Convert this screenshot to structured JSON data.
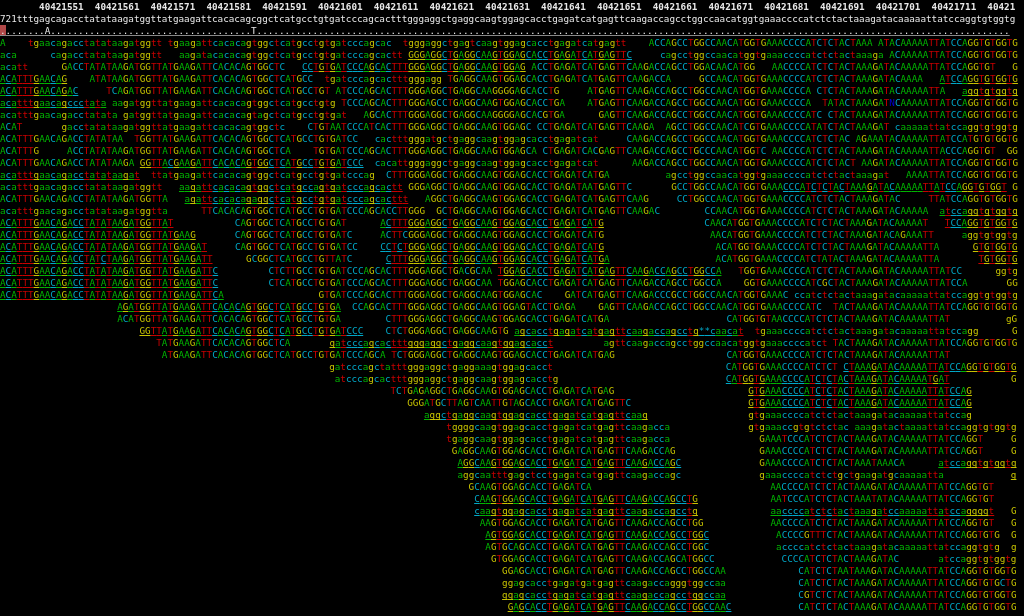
{
  "ruler": "       40421551  40421561  40421571  40421581  40421591  40421601  40421611  40421621  40421631  40421641  40421651  40421661  40421671  40421681  40421691  40421701  40421711  40421",
  "reference": "721tttgagcagacctatataagatggttatgaagattcacacagcggctcatgcctgtgatcccagcactttgggaggctgaggcaagtggagcacctgagatcatgagttcaagaccagcctggccaacatggtgaaaccccatctctactaaagatacaaaaattatccaggtgtggtg",
  "consensus": [
    {
      "text": ".",
      "highlighted": true
    },
    {
      "text": ".......A....................................T.......................................................................................................................................",
      "highlighted": false
    }
  ],
  "rows": [
    {
      "reads": [
        {
          "text": "A",
          "underlined": false
        },
        {
          "text": "    tgaacagacctatataagatggtt",
          "underlined": false
        },
        {
          "text": " tgaagattcacacagtggctcatgcctgtgatcccagcac",
          "underlined": false
        },
        {
          "text": "  tgggaggctgagtcaagtggagcacctgagatcatgagtt",
          "underlined": false
        },
        {
          "text": "    ACCAGCCTGGCCAACATGGTGAAACCCCATCTCTACTAAA",
          "underlined": false
        },
        {
          "text": " ATACAAAAATTATCCAGGTGTGGTG",
          "underlined": false
        }
      ]
    },
    {
      "reads": [
        {
          "text": "aca",
          "underlined": false
        },
        {
          "text": "      cagacctatataagatggtt",
          "underlined": false
        },
        {
          "text": "   aagatacacacagtggctcatgcctgtgatcccagcactt",
          "underlined": false
        },
        {
          "text": " GGGAGGCTGAGGCAAGTGGAGCACCTGAGATCATGAGTTC",
          "underlined": true
        },
        {
          "text": "     cagcctggccaacatggtgaaaccccatctctactaaaga",
          "underlined": false
        },
        {
          "text": " ACAAAAATTATCCAGGTGTGGTG",
          "underlined": false
        }
      ]
    },
    {
      "reads": [
        {
          "text": "acatt",
          "underlined": false
        },
        {
          "text": "      GACCTATATAAGATGGTTATGAAGATTCACACAGTGGCTC",
          "underlined": false
        },
        {
          "text": "   CCTGTGATCCCAGCACTTTGGGAGGCTGAGGCAAGTGGAG",
          "underlined": true
        },
        {
          "text": " ACCTGAGATCATGAGTTCAAGACCAGCCTGGACAACATGG",
          "underlined": false
        },
        {
          "text": "   AACCCCATCTCTACTAAAGATACAAAAATTATCCAGGTGT",
          "underlined": false
        },
        {
          "text": "   G",
          "underlined": false
        }
      ]
    },
    {
      "reads": [
        {
          "text": "ACATTTGAACAG",
          "underlined": true
        },
        {
          "text": "    ATATAAGATGGTTATGAAGATTCACACAGTGGCTCATGCC",
          "underlined": false
        },
        {
          "text": "  tgatcccagcactttgggagg",
          "underlined": false
        },
        {
          "text": " TGAGGCAAGTGGAGCACCTGAGATCATGAGTTCAAGACCA",
          "underlined": false
        },
        {
          "text": "     GCCAACATGGTGAAACCCCATCTCTACTAAAGATACAAAA",
          "underlined": false
        },
        {
          "text": "   ATCCAGGTGTGGTG",
          "underlined": true
        }
      ]
    },
    {
      "reads": [
        {
          "text": "ACATTTGAACAGAC",
          "underlined": true
        },
        {
          "text": "     TCAGATGGTTATGAAGATTCACACAGTGGCTCATGCCTGT",
          "underlined": false
        },
        {
          "text": " ATCCCAGCACTTTGGGAGGCTGAGGCAAGGGGAGCACCTG",
          "underlined": false
        },
        {
          "text": "     ATGAGTTCAAGACCAGCCTGGCCAACATGGTGAAACCCCA",
          "underlined": false
        },
        {
          "text": " CTCTACTAAAGATACAAAAATTA",
          "underlined": false
        },
        {
          "text": "   aggtgtggtg",
          "underlined": true
        }
      ]
    },
    {
      "reads": [
        {
          "text": "acatttgaacagccctata",
          "underlined": true
        },
        {
          "text": " aagatggttatgaagattcacacagtggctcatgcctgtg",
          "underlined": false
        },
        {
          "text": " TCCCAGCACTTTGGGAGCCTGAGGCAAGTGGAGCACCTGA",
          "underlined": false
        },
        {
          "text": "    ATGAGTTCAAGACCAGCCTGGCCAACATGGTGAAACCCCA",
          "underlined": false
        },
        {
          "text": "  TATACTAAAGATNCAAAAATTATCCAGGTGTGGTG",
          "underlined": false
        }
      ]
    },
    {
      "reads": [
        {
          "text": "acatttgaacagacctatata",
          "underlined": false
        },
        {
          "text": " gatggttatgaagattcacacagtagctcatgcctgtgat",
          "underlined": false
        },
        {
          "text": "   AGCACTTTGGGAGGCTGAGGCAAGGGGAGCACGTGA",
          "underlined": false
        },
        {
          "text": "      GAGTTCAAGACCAGCCTGGCCAACATGGTGAAACCCCATC",
          "underlined": false
        },
        {
          "text": " CTACTAAAGATACAAAAATTATCCAGGTGTGGTG",
          "underlined": false
        }
      ]
    },
    {
      "reads": [
        {
          "text": "ACAT",
          "underlined": false
        },
        {
          "text": "       gacctatataagatggttatgaagattcacacagtggctc",
          "underlined": false
        },
        {
          "text": "    CTGTAATCCCATCACTTTGGGAGGCTGAGGCAAGTGGAGC",
          "underlined": false
        },
        {
          "text": " CCTGAGATCATGAGTTCAAGA",
          "underlined": false
        },
        {
          "text": "  AGCCTGGCCAACATCGTGAAACCCCATATCTACTAAAGAT",
          "underlined": false
        },
        {
          "text": " caaaaattatccaggtgtggtg",
          "underlined": false
        }
      ]
    },
    {
      "reads": [
        {
          "text": "ACATTTGAACAGACCTATATAA",
          "underlined": false
        },
        {
          "text": "  TGGTTATGAAGATTCACACAGTGGCTCATGCCTGTGATCC",
          "underlined": false
        },
        {
          "text": "   cactttgggatgctgaggcaagtggagcacctgagatcat",
          "underlined": false
        },
        {
          "text": "     CAAGACCAGCCTGGCCAACATGGTGAAACCCCATCTCTAC",
          "underlined": false
        },
        {
          "text": " AGAAATACAAAAATTATCCATGTGTGGTG",
          "underlined": false
        }
      ]
    },
    {
      "reads": [
        {
          "text": "ACATTTG",
          "underlined": false
        },
        {
          "text": "     ACCTATATAAGATGGTTATGAAGATTCACACAGTGGCTCA",
          "underlined": false
        },
        {
          "text": "    TGTGATCCCAGCACTTTGGGAGGCTGAGGCAAGTGGAGCA",
          "underlined": false
        },
        {
          "text": " CTGAGATCACGAGTTCAAGACCAGCCTGCCCAACATGGTC",
          "underlined": false
        },
        {
          "text": " AACCCCATCTCTACTAAAGATACAAAAATTACCCAGGTGT",
          "underlined": false
        },
        {
          "text": "  GG",
          "underlined": false
        }
      ]
    },
    {
      "reads": [
        {
          "text": "ACATTTGAACAGACCTATATAAGA",
          "underlined": false
        },
        {
          "text": " GGTTACGAAGATTCACACAGTGGCTCATGCCTGTGATCCC",
          "underlined": true
        },
        {
          "text": "  cacattgggaggctgaggcaagtggagcacctgagatcat",
          "underlined": false
        },
        {
          "text": "      AAGACCAGCCTGGCCAACATGGTGAAACCCCATCTCTACT",
          "underlined": false
        },
        {
          "text": " AAGATACAAAAATTATCCAGGTGTGGTG",
          "underlined": false
        }
      ]
    },
    {
      "reads": [
        {
          "text": "acatttgaacagacctatataagat",
          "underlined": true
        },
        {
          "text": "  ttatgaagattcacacagtggctcatgcctgtgatcccag",
          "underlined": false
        },
        {
          "text": "  CTTTGGGAGGCTGAGGCAAGTGGAGCACCTGAGATCATGA",
          "underlined": false
        },
        {
          "text": "          agcctggccaacatggtgaaaccccatctctactaaagat",
          "underlined": false
        },
        {
          "text": "   AAAATTATCCAGGTGTGGTG",
          "underlined": false
        }
      ]
    },
    {
      "reads": [
        {
          "text": "acatttgaacagacctatataagatggtt",
          "underlined": false
        },
        {
          "text": "   aagattcacacagtggctcatgccagtgatcccagcactt",
          "underlined": true
        },
        {
          "text": " GGGAGGCTGAGGCAAGTGGAGCACCTGAGATAATGAGTTC",
          "underlined": false
        },
        {
          "text": "       GCCTGGCCAACATGGTGAAA",
          "underlined": false
        },
        {
          "text": "CCCATCTCTACTAAAGATACAAAAATTATCCAGGTGTGGT",
          "underlined": true
        },
        {
          "text": " G",
          "underlined": false
        }
      ]
    },
    {
      "reads": [
        {
          "text": "ACATTTGAACAGACCTATATAAGATGGTTA",
          "underlined": false
        },
        {
          "text": "   agattcacacagaggctcatgcctgtgatcccagcacttt",
          "underlined": true
        },
        {
          "text": "   AGGCTGAGGCAAGTGGAGCACCTGAGATCATGAGTTCAAG",
          "underlined": false
        },
        {
          "text": "     CCTGGCCAACATGGTGAAACCCCATCTCTACTAAAGATAC",
          "underlined": false
        },
        {
          "text": "     TTATCCAGGTGTGGTG",
          "underlined": false
        }
      ]
    },
    {
      "reads": [
        {
          "text": "acatttgaacagacctatataagatggtta",
          "underlined": false
        },
        {
          "text": "      TTCACACAGTGGCTCATGCCTGTGATCCCAGCACCTTGGG",
          "underlined": false
        },
        {
          "text": "  GCTGAGGCAAGTGGAGCACCTGAGATCATGAGTTCAAGAC",
          "underlined": false
        },
        {
          "text": "        CCAACATGGTGAAACCCCATCTCTACTAAAGATACAAAAA",
          "underlined": false
        },
        {
          "text": "  atccaggtgtggtg",
          "underlined": true
        }
      ]
    },
    {
      "reads": [
        {
          "text": "ACATTTGAACAGACCTATATAAGATGGTTAT",
          "underlined": true
        },
        {
          "text": "           CAGTGGCTCATGCCTGTGAT",
          "underlined": false
        },
        {
          "text": "      ACTTTGGGAGGCTGAGGCAAGTGGAGCACCTGAGATCATG",
          "underlined": true
        },
        {
          "text": "                  CAACATGGTGAAACCCCATCTCTACTAAAGATACAAAAAT",
          "underlined": false
        },
        {
          "text": "   TCCAGGTGTGGTG",
          "underlined": true
        }
      ]
    },
    {
      "reads": [
        {
          "text": "ACATTTGAACAGACCTATATAAGATGGTTATGAAG",
          "underlined": true
        },
        {
          "text": "       CAGTGGCTCATGCCTGTGATC",
          "underlined": false
        },
        {
          "text": "     ACTTCGGGAGGCTGAGGCAAGTGGAGCACCTGAGATCATG",
          "underlined": false
        },
        {
          "text": "                   AACATGGTGAAACCCCATCTCTACTAAAGATACAGAAATT",
          "underlined": false
        },
        {
          "text": "     aggtgtggtg",
          "underlined": false
        }
      ]
    },
    {
      "reads": [
        {
          "text": "ACATTTGAACAGACCTATATAAGATGGTTATGAAGAT",
          "underlined": true
        },
        {
          "text": "     CAGTGGCTCATGCCTGTGATCC",
          "underlined": false
        },
        {
          "text": "    CCTCTGGGAGGCTGAGGCAAGTGGAGCACCTGAGATCATG",
          "underlined": true
        },
        {
          "text": "                    ACATGGTGAAACCCCATCTCTACTAAAGATACAAAAATTA",
          "underlined": false
        },
        {
          "text": "      GTGTGGTG",
          "underlined": true
        }
      ]
    },
    {
      "reads": [
        {
          "text": "ACATTTGAACAGACCTATCTAAGATGGTTATGAAGATT",
          "underlined": true
        },
        {
          "text": "      GCGGCTCATGCCTGTTATC",
          "underlined": false
        },
        {
          "text": "      CTTTGGGAGGCTGAGGCAAGTGGAGCACCTGAGATCATGA",
          "underlined": true
        },
        {
          "text": "                   ACATGGTGAAACCCCATCTATACTAAAGATACAAAAATTA",
          "underlined": false
        },
        {
          "text": "       TGTGGTG",
          "underlined": true
        }
      ]
    },
    {
      "reads": [
        {
          "text": "ACATTTGAACAGACCTATATAAGATGGTTATGAAGATTC",
          "underlined": true
        },
        {
          "text": "         CTCTTGCCTGTGATCCCAGCACTTTGGGAGGCTGACGCAA",
          "underlined": false
        },
        {
          "text": " TGGAGCACCTGAGATCATGAGTTCAAGACCAGCCTGGCCA",
          "underlined": true
        },
        {
          "text": "   TGGTGAAACCCCATCTCTACTAAAGATACAAAAATTATCC",
          "underlined": false
        },
        {
          "text": "      ggtg",
          "underlined": false
        }
      ]
    },
    {
      "reads": [
        {
          "text": "ACATTTGAACAGACCTATATAAGATGGTTATGAAGATTC",
          "underlined": true
        },
        {
          "text": "         CTCATGCCTGTGATCCCAGCACTTTGGGAGGCTGAGGCAA",
          "underlined": false
        },
        {
          "text": " TGGAGCACCTGAGATCATGAGTTCAAGACCAGCCTGGCCA",
          "underlined": false
        },
        {
          "text": "    GGTGAAACCCCATCGCTACTAAAGATACAAAAATTATCCA",
          "underlined": false
        },
        {
          "text": "       GG",
          "underlined": false
        }
      ]
    },
    {
      "reads": [
        {
          "text": "ACATTTGAACAGACCTATATAAGATGGTTATGAAGATTCA",
          "underlined": true
        },
        {
          "text": "                 GTGATCCCAGCACTTTGGGAGGCTGAGGCAAGTGGAGCAC",
          "underlined": false
        },
        {
          "text": "    GATCATGAGTTCAAGACCCGCCTGGCCAACATGGTGAAAC",
          "underlined": false
        },
        {
          "text": " ccatctctactaaagatacaaaaattatccaggtgtggtg",
          "underlined": false
        }
      ]
    },
    {
      "reads": [
        {
          "text": "                     AGATGGTTATGAAGATTCACACAGTGGCTCATGCCTGTGA",
          "underlined": true
        },
        {
          "text": "  CCAGCACTTTGGGAGGCTGAGGCAAGTGGAGTACCTGAGA",
          "underlined": false
        },
        {
          "text": "    GAGTTCAAGACCAGCCTGGCCAACATGGTGAAACCCCATC",
          "underlined": false
        },
        {
          "text": "  TACTAAAGATACAAAAATTATCCAGGTGTGGTG",
          "underlined": false
        }
      ]
    },
    {
      "reads": [
        {
          "text": "                     ACATGGTTATGAAGATTCACACAGTGGCTCATGCCTGTGA",
          "underlined": false
        },
        {
          "text": "        CTTTGGGAGGCTGAGGCAAGTGGAGCACCTGAGATCATGA",
          "underlined": false
        },
        {
          "text": "                     CATGGTGTAACCCCATCTCTACTAAAGATACAAAAATTAT",
          "underlined": false
        },
        {
          "text": "          gG",
          "underlined": false
        }
      ]
    },
    {
      "reads": [
        {
          "text": "                         GGTTATGAAGATTCACACAGTGGCTCATGCCTGTGATCCC",
          "underlined": true
        },
        {
          "text": "    CTCTGGGAGGCTGAGGCAAGTG",
          "underlined": false
        },
        {
          "text": " agcacctgagatcatgagttcaagaccagcctg**caacat",
          "underlined": true
        },
        {
          "text": "  tgaaaccccatctctactaaagatacaaaaattatccagg",
          "underlined": false
        },
        {
          "text": "      G",
          "underlined": false
        }
      ]
    },
    {
      "reads": [
        {
          "text": "                            TATGAAGATTCACACAGTGGCTCA",
          "underlined": false
        },
        {
          "text": "       gatcccagcactttgggaggctgaggcaagtggagcacct",
          "underlined": true
        },
        {
          "text": "         agttcaagaccagcctggccaacatggtgaaaccccatct",
          "underlined": false
        },
        {
          "text": " TACTAAAGATACAAAAATTATCCAGGTGTGGTG",
          "underlined": false
        }
      ]
    },
    {
      "reads": [
        {
          "text": "                             ATGAAGATTCACACAGTGGCTCATGCCTGTGATCCCAGCA",
          "underlined": false
        },
        {
          "text": " TCTGGGAGGCTGAGGCAAGTGGAGCACCTGAGATCATGAG",
          "underlined": false
        },
        {
          "text": "                    CATGGTGAAACCCCATCTCTACTAAAGATACAAAAATTAT",
          "underlined": false
        }
      ]
    },
    {
      "reads": [
        {
          "text": "                                                           gatcccagctatttgggaggctgaggaaagtggagcacct",
          "underlined": false
        },
        {
          "text": "                               CATGGTGAAACCCCATCTCT",
          "underlined": false
        },
        {
          "text": " CTAAAGATACAAAAATTATCCAGGTGTGGTG",
          "underlined": true
        }
      ]
    },
    {
      "reads": [
        {
          "text": "                                                            atcccagcactttgggaggctgaggcaagtggagcacctg",
          "underlined": false
        },
        {
          "text": "                              CATGGTGAAACCCCATCTCTACTAAAGATACAAAAATGAT",
          "underlined": true
        },
        {
          "text": "           G",
          "underlined": false
        }
      ]
    },
    {
      "reads": [
        {
          "text": "                                                                      TCTGAGAGGCTGAGGCAAGTGGAGCACCTGAGATCATGAG",
          "underlined": false
        },
        {
          "text": "                        GTGAAACCCCATCTCTACTAAAGATACAAAAATTATCCAG",
          "underlined": true
        }
      ]
    },
    {
      "reads": [
        {
          "text": "                                                                         GGGATGCTTAGTCAATTGTAGCACCTGAGATCATGAGTTC",
          "underlined": false
        },
        {
          "text": "                     GTGAAACCCCATCTCTACTAAAGATACAAAAATTATCCAG",
          "underlined": true
        }
      ]
    },
    {
      "reads": [
        {
          "text": "                                                                            aggctgaggcaagtggagcacctgagatcatgagttcaag",
          "underlined": true
        },
        {
          "text": "                  gtgaaaccccatctctactaaagatacaaaaattatccag",
          "underlined": false
        }
      ]
    },
    {
      "reads": [
        {
          "text": "                                                                                tggggcaagtggagcacctgagatcatgagttcaagacca",
          "underlined": false
        },
        {
          "text": "              gtgaaaccgtgtctctac",
          "underlined": false
        },
        {
          "text": " aaagatactaaaattatccaggtgtggtg",
          "underlined": false
        }
      ]
    },
    {
      "reads": [
        {
          "text": "                                                                                tgaggcaagtggagcacctgagatcatgagttcaagacca",
          "underlined": false
        },
        {
          "text": "                GAAATCCCATCTCTACTAAAGATACAAAAATTATCCAGGT",
          "underlined": false
        },
        {
          "text": "     G",
          "underlined": false
        }
      ]
    },
    {
      "reads": [
        {
          "text": "                                                                                 GAGGCAAGTGGAGCACCTGAGATCATGAGTTCAAGACCAG",
          "underlined": false
        },
        {
          "text": "               GAAACCCCATCTCTACTAAAGATACAAAAATTATCCAGGT",
          "underlined": false
        },
        {
          "text": "     G",
          "underlined": false
        }
      ]
    },
    {
      "reads": [
        {
          "text": "                                                                                  AGGCAAGTGGAGCACCTGAGATCATGAGTTCAAGACCAGC",
          "underlined": true
        },
        {
          "text": "              GAAACCCCATCTCTACTAAATAAACA",
          "underlined": false
        },
        {
          "text": "      atccaggtgtggtg",
          "underlined": true
        }
      ]
    },
    {
      "reads": [
        {
          "text": "                                                                                  aggcaatttgagctcctgagatcatgagttcaagaccagc",
          "underlined": false
        },
        {
          "text": "              gaaaccccatctctgctgaagatgcaaaaatta",
          "underlined": false
        },
        {
          "text": "            g",
          "underlined": true
        }
      ]
    },
    {
      "reads": [
        {
          "text": "                                                                                    GCAAGTGGAGCACCTGAGATCA",
          "underlined": false
        },
        {
          "text": "                                AACCCCATCTCTACTAAAGATACAAAAATTATCCAGGTGT",
          "underlined": false
        }
      ]
    },
    {
      "reads": [
        {
          "text": "                                                                                     CAAGTGGAGCACCTGAGATCATGAGTTCAAGACCAGCCTG",
          "underlined": true
        },
        {
          "text": "             AATCCCATCTCTACTAAATATACAAAAATTATCCAGGTGT",
          "underlined": false
        }
      ]
    },
    {
      "reads": [
        {
          "text": "                                                                                     caagtggagcacctgagatcatgagttcaagaccagcctg",
          "underlined": true
        },
        {
          "text": "             aaccccatctctactaaagatccaaaaattatccaggggt",
          "underlined": true
        },
        {
          "text": "   G",
          "underlined": false
        }
      ]
    },
    {
      "reads": [
        {
          "text": "                                                                                      AAGTGGAGCACCTGAGATCATGAGTTCAAGACCAGCCTGG",
          "underlined": false
        },
        {
          "text": "            AACCCCATCTCTACTAAAGATACAAAAATTATCCAGGTGT",
          "underlined": false
        },
        {
          "text": "   G",
          "underlined": false
        }
      ]
    },
    {
      "reads": [
        {
          "text": "                                                                                       AGTGGAGCACCTGAGATCATGAGTTCAAGACCAGCCTGGC",
          "underlined": true
        },
        {
          "text": "            ACCCCGTTTCTACTAAAGATACAAAAATTATCCAGGTGTG",
          "underlined": false
        },
        {
          "text": "  G",
          "underlined": false
        }
      ]
    },
    {
      "reads": [
        {
          "text": "                                                                                       AGTGCAGCACCTGAGATCATGAGTTCAAGACCAGCCTGGC",
          "underlined": false
        },
        {
          "text": "            accccatctctactaaagatacaaaaattatccaggtgtg",
          "underlined": false
        },
        {
          "text": "  g",
          "underlined": false
        }
      ]
    },
    {
      "reads": [
        {
          "text": "                                                                                        GTGGAGCACCTGAGATCATGAGTTCAAGACCAGCATGGCC",
          "underlined": false
        },
        {
          "text": "            CCCCATCTCTACTAAAGATAC",
          "underlined": false
        },
        {
          "text": "       atccaggtgtggtg",
          "underlined": false
        }
      ]
    },
    {
      "reads": [
        {
          "text": "                                                                                          GGAGCACCTGAGATCATGAGTTCAAGACCAGCCTGGCCAA",
          "underlined": false
        },
        {
          "text": "             CATCTCTAATAAAGATACAAAAATTATCCAGGTGTGGTG",
          "underlined": false
        }
      ]
    },
    {
      "reads": [
        {
          "text": "                                                                                          ggagcacctgagatgatgagttcaagaccagggtggccaa",
          "underlined": false
        },
        {
          "text": "             CATCTCTACTAAAGATACAAAAATTATCCAGGTGTGCTG",
          "underlined": false
        }
      ]
    },
    {
      "reads": [
        {
          "text": "                                                                                          ggagcacctgagatcatgagttcaagaccagcctggccaa",
          "underlined": true
        },
        {
          "text": "             CGTCTCTACTAAAGATACAAAAATTATCCAGGTGTGGTG",
          "underlined": false
        }
      ]
    },
    {
      "reads": [
        {
          "text": "                                                                                           GAGCACCTGAGATCATGAGTTCAAGACCAGCCTGGCCAAC",
          "underlined": true
        },
        {
          "text": "            CATCTCTACTAAAGATACAAAAATTATCCAGGTGTGGTG",
          "underlined": false
        }
      ]
    }
  ]
}
